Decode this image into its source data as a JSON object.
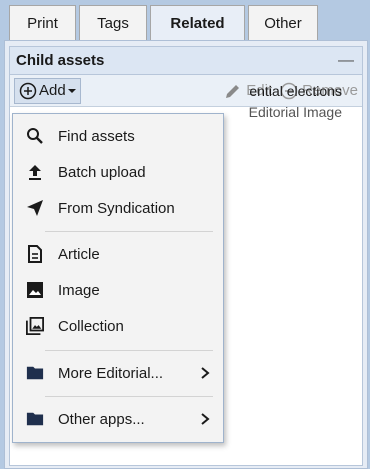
{
  "tabs": [
    {
      "label": "Print"
    },
    {
      "label": "Tags"
    },
    {
      "label": "Related"
    },
    {
      "label": "Other"
    }
  ],
  "panel": {
    "title": "Child assets",
    "collapse_label": "—"
  },
  "toolbar": {
    "add_label": "Add",
    "edit_label": "Edit",
    "remove_label": "Remove"
  },
  "asset": {
    "title_fragment": "ential elections",
    "type": "Editorial Image"
  },
  "menu": {
    "items": [
      {
        "label": "Find assets",
        "icon": "search-icon"
      },
      {
        "label": "Batch upload",
        "icon": "upload-icon"
      },
      {
        "label": "From Syndication",
        "icon": "send-icon"
      },
      {
        "label": "Article",
        "icon": "article-icon"
      },
      {
        "label": "Image",
        "icon": "image-icon"
      },
      {
        "label": "Collection",
        "icon": "collection-icon"
      },
      {
        "label": "More Editorial...",
        "icon": "folder-icon"
      },
      {
        "label": "Other apps...",
        "icon": "folder-icon"
      }
    ]
  },
  "colors": {
    "background": "#b4c9e2",
    "active_tab": "#e8eef7",
    "menu_bg": "#f3f3f3",
    "folder": "#1f2f4d"
  }
}
